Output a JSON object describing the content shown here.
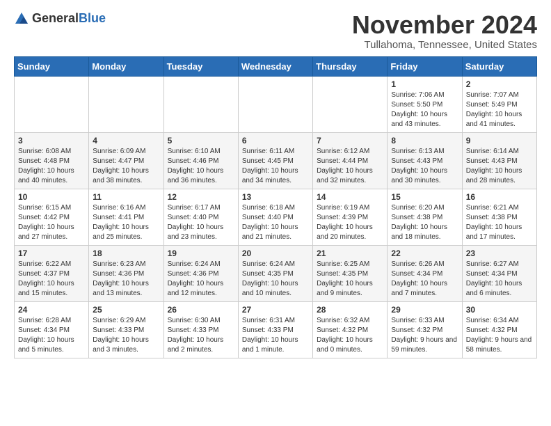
{
  "logo": {
    "general": "General",
    "blue": "Blue"
  },
  "header": {
    "month": "November 2024",
    "location": "Tullahoma, Tennessee, United States"
  },
  "days_of_week": [
    "Sunday",
    "Monday",
    "Tuesday",
    "Wednesday",
    "Thursday",
    "Friday",
    "Saturday"
  ],
  "weeks": [
    [
      {
        "day": "",
        "info": ""
      },
      {
        "day": "",
        "info": ""
      },
      {
        "day": "",
        "info": ""
      },
      {
        "day": "",
        "info": ""
      },
      {
        "day": "",
        "info": ""
      },
      {
        "day": "1",
        "info": "Sunrise: 7:06 AM\nSunset: 5:50 PM\nDaylight: 10 hours and 43 minutes."
      },
      {
        "day": "2",
        "info": "Sunrise: 7:07 AM\nSunset: 5:49 PM\nDaylight: 10 hours and 41 minutes."
      }
    ],
    [
      {
        "day": "3",
        "info": "Sunrise: 6:08 AM\nSunset: 4:48 PM\nDaylight: 10 hours and 40 minutes."
      },
      {
        "day": "4",
        "info": "Sunrise: 6:09 AM\nSunset: 4:47 PM\nDaylight: 10 hours and 38 minutes."
      },
      {
        "day": "5",
        "info": "Sunrise: 6:10 AM\nSunset: 4:46 PM\nDaylight: 10 hours and 36 minutes."
      },
      {
        "day": "6",
        "info": "Sunrise: 6:11 AM\nSunset: 4:45 PM\nDaylight: 10 hours and 34 minutes."
      },
      {
        "day": "7",
        "info": "Sunrise: 6:12 AM\nSunset: 4:44 PM\nDaylight: 10 hours and 32 minutes."
      },
      {
        "day": "8",
        "info": "Sunrise: 6:13 AM\nSunset: 4:43 PM\nDaylight: 10 hours and 30 minutes."
      },
      {
        "day": "9",
        "info": "Sunrise: 6:14 AM\nSunset: 4:43 PM\nDaylight: 10 hours and 28 minutes."
      }
    ],
    [
      {
        "day": "10",
        "info": "Sunrise: 6:15 AM\nSunset: 4:42 PM\nDaylight: 10 hours and 27 minutes."
      },
      {
        "day": "11",
        "info": "Sunrise: 6:16 AM\nSunset: 4:41 PM\nDaylight: 10 hours and 25 minutes."
      },
      {
        "day": "12",
        "info": "Sunrise: 6:17 AM\nSunset: 4:40 PM\nDaylight: 10 hours and 23 minutes."
      },
      {
        "day": "13",
        "info": "Sunrise: 6:18 AM\nSunset: 4:40 PM\nDaylight: 10 hours and 21 minutes."
      },
      {
        "day": "14",
        "info": "Sunrise: 6:19 AM\nSunset: 4:39 PM\nDaylight: 10 hours and 20 minutes."
      },
      {
        "day": "15",
        "info": "Sunrise: 6:20 AM\nSunset: 4:38 PM\nDaylight: 10 hours and 18 minutes."
      },
      {
        "day": "16",
        "info": "Sunrise: 6:21 AM\nSunset: 4:38 PM\nDaylight: 10 hours and 17 minutes."
      }
    ],
    [
      {
        "day": "17",
        "info": "Sunrise: 6:22 AM\nSunset: 4:37 PM\nDaylight: 10 hours and 15 minutes."
      },
      {
        "day": "18",
        "info": "Sunrise: 6:23 AM\nSunset: 4:36 PM\nDaylight: 10 hours and 13 minutes."
      },
      {
        "day": "19",
        "info": "Sunrise: 6:24 AM\nSunset: 4:36 PM\nDaylight: 10 hours and 12 minutes."
      },
      {
        "day": "20",
        "info": "Sunrise: 6:24 AM\nSunset: 4:35 PM\nDaylight: 10 hours and 10 minutes."
      },
      {
        "day": "21",
        "info": "Sunrise: 6:25 AM\nSunset: 4:35 PM\nDaylight: 10 hours and 9 minutes."
      },
      {
        "day": "22",
        "info": "Sunrise: 6:26 AM\nSunset: 4:34 PM\nDaylight: 10 hours and 7 minutes."
      },
      {
        "day": "23",
        "info": "Sunrise: 6:27 AM\nSunset: 4:34 PM\nDaylight: 10 hours and 6 minutes."
      }
    ],
    [
      {
        "day": "24",
        "info": "Sunrise: 6:28 AM\nSunset: 4:34 PM\nDaylight: 10 hours and 5 minutes."
      },
      {
        "day": "25",
        "info": "Sunrise: 6:29 AM\nSunset: 4:33 PM\nDaylight: 10 hours and 3 minutes."
      },
      {
        "day": "26",
        "info": "Sunrise: 6:30 AM\nSunset: 4:33 PM\nDaylight: 10 hours and 2 minutes."
      },
      {
        "day": "27",
        "info": "Sunrise: 6:31 AM\nSunset: 4:33 PM\nDaylight: 10 hours and 1 minute."
      },
      {
        "day": "28",
        "info": "Sunrise: 6:32 AM\nSunset: 4:32 PM\nDaylight: 10 hours and 0 minutes."
      },
      {
        "day": "29",
        "info": "Sunrise: 6:33 AM\nSunset: 4:32 PM\nDaylight: 9 hours and 59 minutes."
      },
      {
        "day": "30",
        "info": "Sunrise: 6:34 AM\nSunset: 4:32 PM\nDaylight: 9 hours and 58 minutes."
      }
    ]
  ]
}
